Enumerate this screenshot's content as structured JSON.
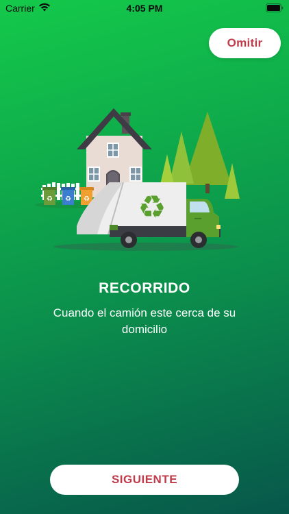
{
  "status_bar": {
    "carrier": "Carrier",
    "time": "4:05 PM",
    "icons": [
      "wifi-icon",
      "battery-icon"
    ]
  },
  "skip_button": {
    "label": "Omitir"
  },
  "illustration": {
    "name": "recycling-truck-house-illustration",
    "icons": [
      "recycle-icon"
    ]
  },
  "onboarding": {
    "title": "RECORRIDO",
    "description": "Cuando el camión este cerca de su domicilio"
  },
  "next_button": {
    "label": "SIGUIENTE"
  },
  "colors": {
    "gradient_top": "#14c94a",
    "gradient_bottom": "#07574b",
    "button_text": "#c23a4a",
    "button_bg": "#ffffff",
    "text": "#ffffff"
  }
}
